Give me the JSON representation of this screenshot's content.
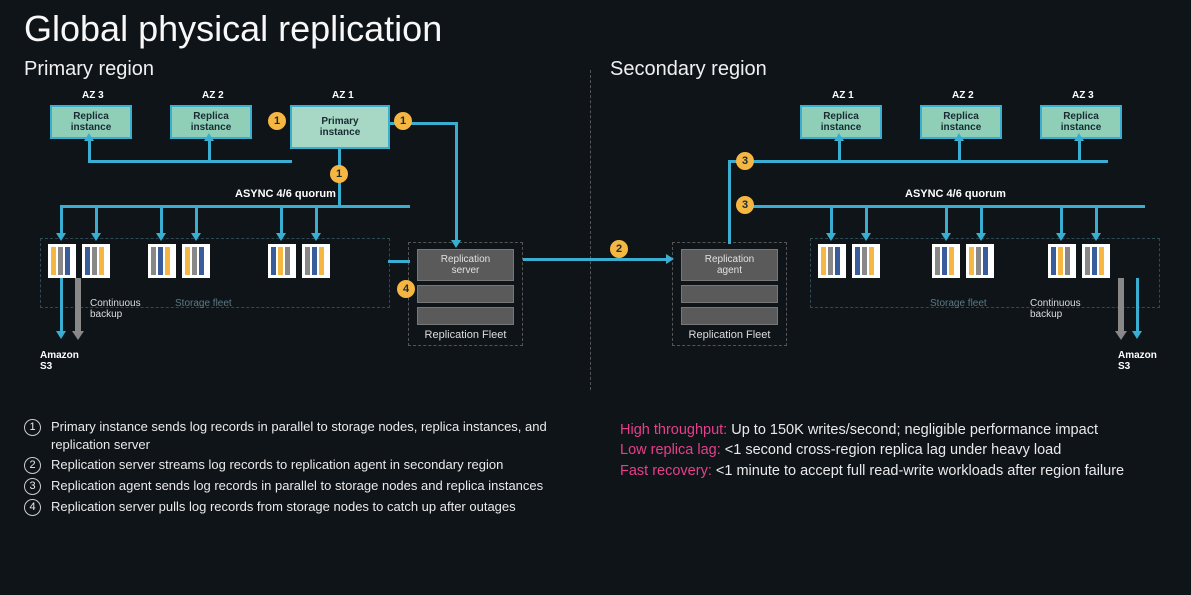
{
  "title": "Global physical replication",
  "regions": {
    "primary": "Primary region",
    "secondary": "Secondary region"
  },
  "az": {
    "az1": "AZ 1",
    "az2": "AZ 2",
    "az3": "AZ 3"
  },
  "instances": {
    "replica": "Replica\ninstance",
    "primary": "Primary\ninstance"
  },
  "async_label": "ASYNC 4/6 quorum",
  "storage_fleet": "Storage fleet",
  "replication_fleet": "Replication Fleet",
  "replication_server": "Replication\nserver",
  "replication_agent": "Replication\nagent",
  "continuous_backup": "Continuous\nbackup",
  "amazon_s3": "Amazon\nS3",
  "steps": {
    "1": "1",
    "2": "2",
    "3": "3",
    "4": "4"
  },
  "legend": [
    {
      "n": "1",
      "t": "Primary instance sends log records in parallel to storage nodes, replica instances, and replication server"
    },
    {
      "n": "2",
      "t": "Replication server streams log records to replication agent in secondary region"
    },
    {
      "n": "3",
      "t": "Replication agent sends log records in parallel to storage nodes and replica instances"
    },
    {
      "n": "4",
      "t": "Replication server pulls log records from storage nodes to catch up after outages"
    }
  ],
  "benefits": [
    {
      "label": "High throughput:",
      "text": " Up to 150K writes/second; negligible performance impact"
    },
    {
      "label": "Low replica lag:",
      "text": " <1 second cross-region replica lag under heavy load"
    },
    {
      "label": "Fast recovery:",
      "text": " <1 minute to accept full read-write workloads after region failure"
    }
  ]
}
